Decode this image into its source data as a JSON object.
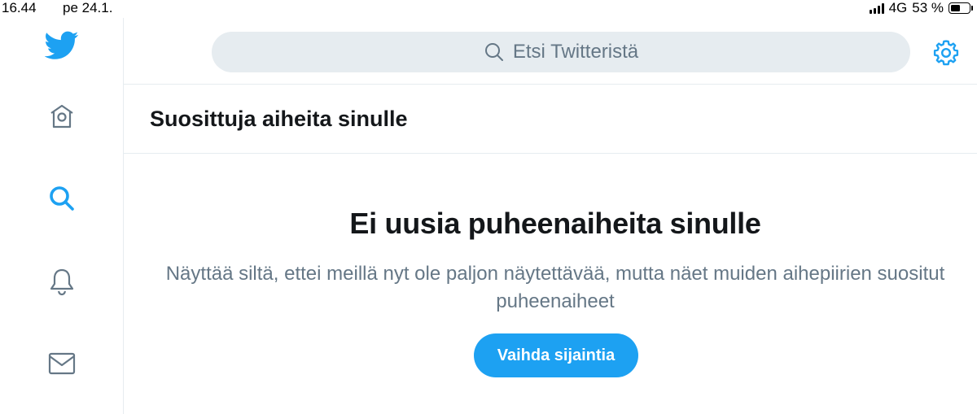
{
  "status_bar": {
    "time": "16.44",
    "date": "pe 24.1.",
    "network": "4G",
    "battery": "53 %",
    "battery_level": 0.53
  },
  "sidebar": {
    "items": [
      {
        "icon": "twitter-bird-icon"
      },
      {
        "icon": "home-icon"
      },
      {
        "icon": "search-icon",
        "active": true
      },
      {
        "icon": "bell-icon"
      },
      {
        "icon": "mail-icon"
      }
    ]
  },
  "search": {
    "placeholder": "Etsi Twitteristä"
  },
  "settings": {
    "icon": "gear-icon"
  },
  "section": {
    "title": "Suosittuja aiheita sinulle"
  },
  "empty_state": {
    "title": "Ei uusia puheenaiheita sinulle",
    "message": "Näyttää siltä, ettei meillä nyt ole paljon näytettävää, mutta näet muiden aihepiirien suositut puheenaiheet",
    "button_label": "Vaihda sijaintia"
  },
  "colors": {
    "accent": "#1da1f2",
    "text_primary": "#14171a",
    "text_secondary": "#657786",
    "search_bg": "#e6ecf0"
  }
}
